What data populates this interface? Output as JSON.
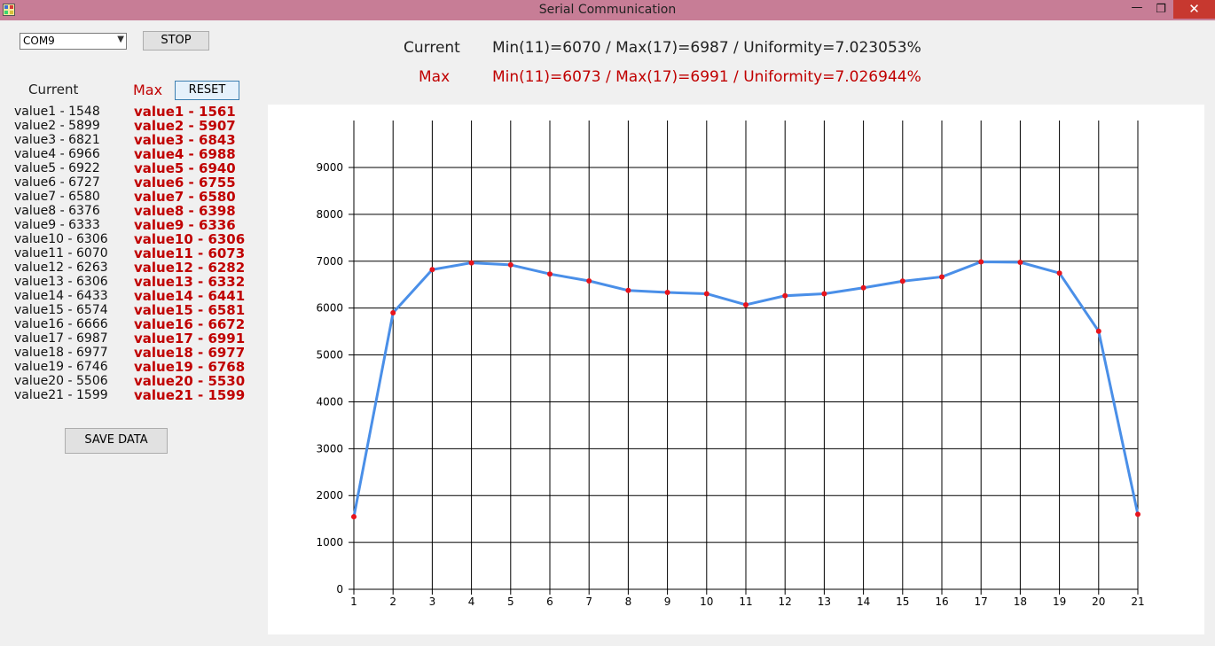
{
  "window": {
    "title": "Serial Communication",
    "min_glyph": "—",
    "max_glyph": "❐",
    "close_glyph": "✕"
  },
  "controls": {
    "port_value": "COM9",
    "stop_label": "STOP",
    "reset_label": "RESET",
    "save_label": "SAVE DATA"
  },
  "panel": {
    "current_header": "Current",
    "max_header": "Max",
    "current_values": [
      "value1 - 1548",
      "value2 - 5899",
      "value3 - 6821",
      "value4 - 6966",
      "value5 - 6922",
      "value6 - 6727",
      "value7 - 6580",
      "value8 - 6376",
      "value9 - 6333",
      "value10 - 6306",
      "value11 - 6070",
      "value12 - 6263",
      "value13 - 6306",
      "value14 - 6433",
      "value15 - 6574",
      "value16 - 6666",
      "value17 - 6987",
      "value18 - 6977",
      "value19 - 6746",
      "value20 - 5506",
      "value21 - 1599"
    ],
    "max_values": [
      "value1 - 1561",
      "value2 - 5907",
      "value3 - 6843",
      "value4 - 6988",
      "value5 - 6940",
      "value6 - 6755",
      "value7 - 6580",
      "value8 - 6398",
      "value9 - 6336",
      "value10 - 6306",
      "value11 - 6073",
      "value12 - 6282",
      "value13 - 6332",
      "value14 - 6441",
      "value15 - 6581",
      "value16 - 6672",
      "value17 - 6991",
      "value18 - 6977",
      "value19 - 6768",
      "value20 - 5530",
      "value21 - 1599"
    ]
  },
  "summary": {
    "current_label": "Current",
    "current_stats": "Min(11)=6070 / Max(17)=6987 / Uniformity=7.023053%",
    "max_label": "Max",
    "max_stats": "Min(11)=6073 / Max(17)=6991 / Uniformity=7.026944%"
  },
  "colors": {
    "titlebar": "#c77d96",
    "max_text": "#c00000",
    "line": "#4a8fe8",
    "marker": "#e8141c",
    "close": "#c7382f"
  },
  "chart_data": {
    "type": "line",
    "x": [
      1,
      2,
      3,
      4,
      5,
      6,
      7,
      8,
      9,
      10,
      11,
      12,
      13,
      14,
      15,
      16,
      17,
      18,
      19,
      20,
      21
    ],
    "series": [
      {
        "values": [
          1548,
          5899,
          6821,
          6966,
          6922,
          6727,
          6580,
          6376,
          6333,
          6306,
          6070,
          6263,
          6306,
          6433,
          6574,
          6666,
          6987,
          6977,
          6746,
          5506,
          1599
        ]
      }
    ],
    "xlim": [
      1,
      21
    ],
    "ylim": [
      0,
      9000
    ],
    "y_ticks": [
      0,
      1000,
      2000,
      3000,
      4000,
      5000,
      6000,
      7000,
      8000,
      9000
    ],
    "grid": true
  }
}
